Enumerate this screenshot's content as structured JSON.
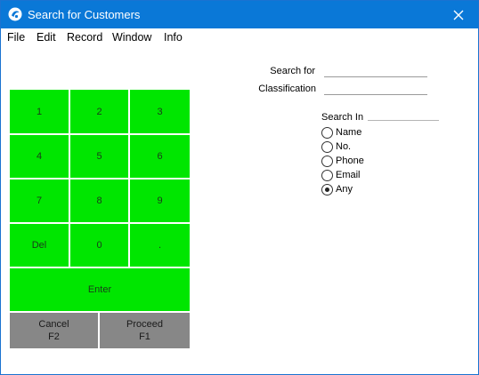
{
  "window": {
    "title": "Search for Customers"
  },
  "menu": [
    "File",
    "Edit",
    "Record",
    "Window",
    "Info"
  ],
  "keypad": {
    "keys": [
      "1",
      "2",
      "3",
      "4",
      "5",
      "6",
      "7",
      "8",
      "9",
      "Del",
      "0",
      "."
    ],
    "enter": "Enter",
    "cancel": {
      "label": "Cancel",
      "shortcut": "F2"
    },
    "proceed": {
      "label": "Proceed",
      "shortcut": "F1"
    }
  },
  "form": {
    "search_for_label": "Search for",
    "search_for_value": "",
    "classification_label": "Classification",
    "classification_value": ""
  },
  "search_in": {
    "label": "Search In",
    "options": [
      "Name",
      "No.",
      "Phone",
      "Email",
      "Any"
    ],
    "selected": "Any"
  },
  "colors": {
    "titlebar": "#0a78d7",
    "key_green": "#00e600",
    "key_gray": "#878787"
  }
}
